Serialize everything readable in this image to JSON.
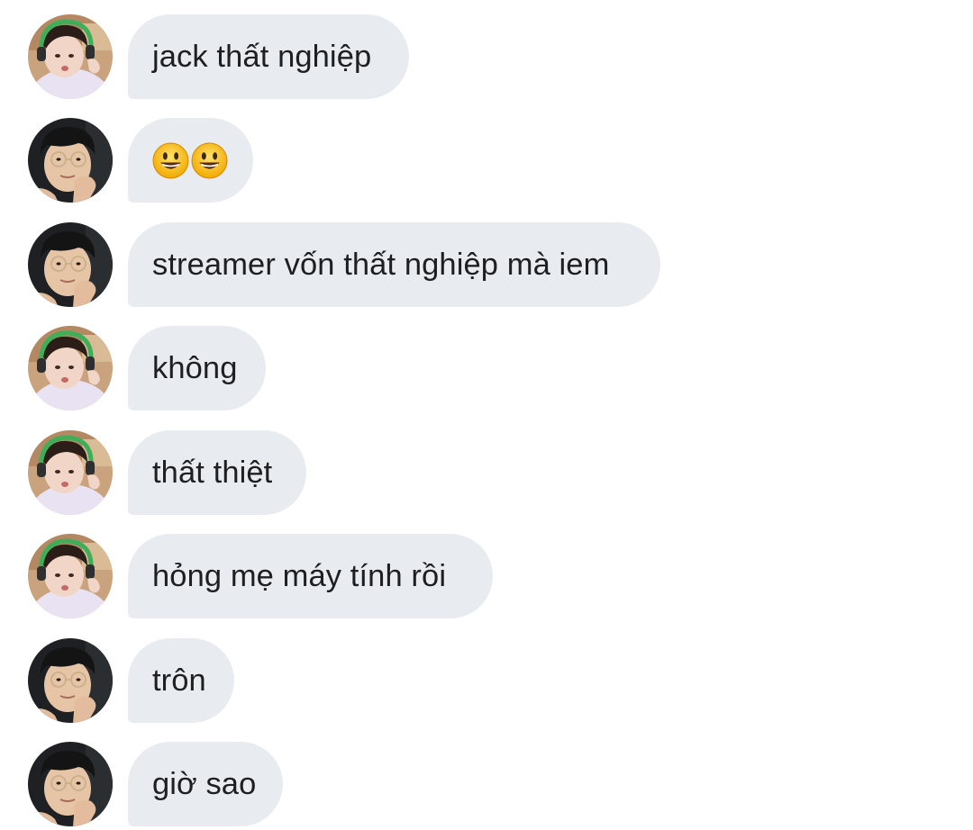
{
  "avatars": {
    "a": "avatar-headset-green",
    "b": "avatar-dark-glasses"
  },
  "colors": {
    "bubble_bg": "#e8ecf0",
    "text": "#1d1f21",
    "background": "#ffffff"
  },
  "messages": [
    {
      "sender": "a",
      "text": "jack thất nghiệp"
    },
    {
      "sender": "b",
      "text": "",
      "emoji": [
        "grinning-face-emoji",
        "grinning-face-emoji"
      ]
    },
    {
      "sender": "b",
      "text": "streamer vốn thất nghiệp mà iem"
    },
    {
      "sender": "a",
      "text": "không"
    },
    {
      "sender": "a",
      "text": "thất thiệt"
    },
    {
      "sender": "a",
      "text": "hỏng mẹ máy tính rồi"
    },
    {
      "sender": "b",
      "text": "trôn"
    },
    {
      "sender": "b",
      "text": "giờ sao"
    }
  ]
}
